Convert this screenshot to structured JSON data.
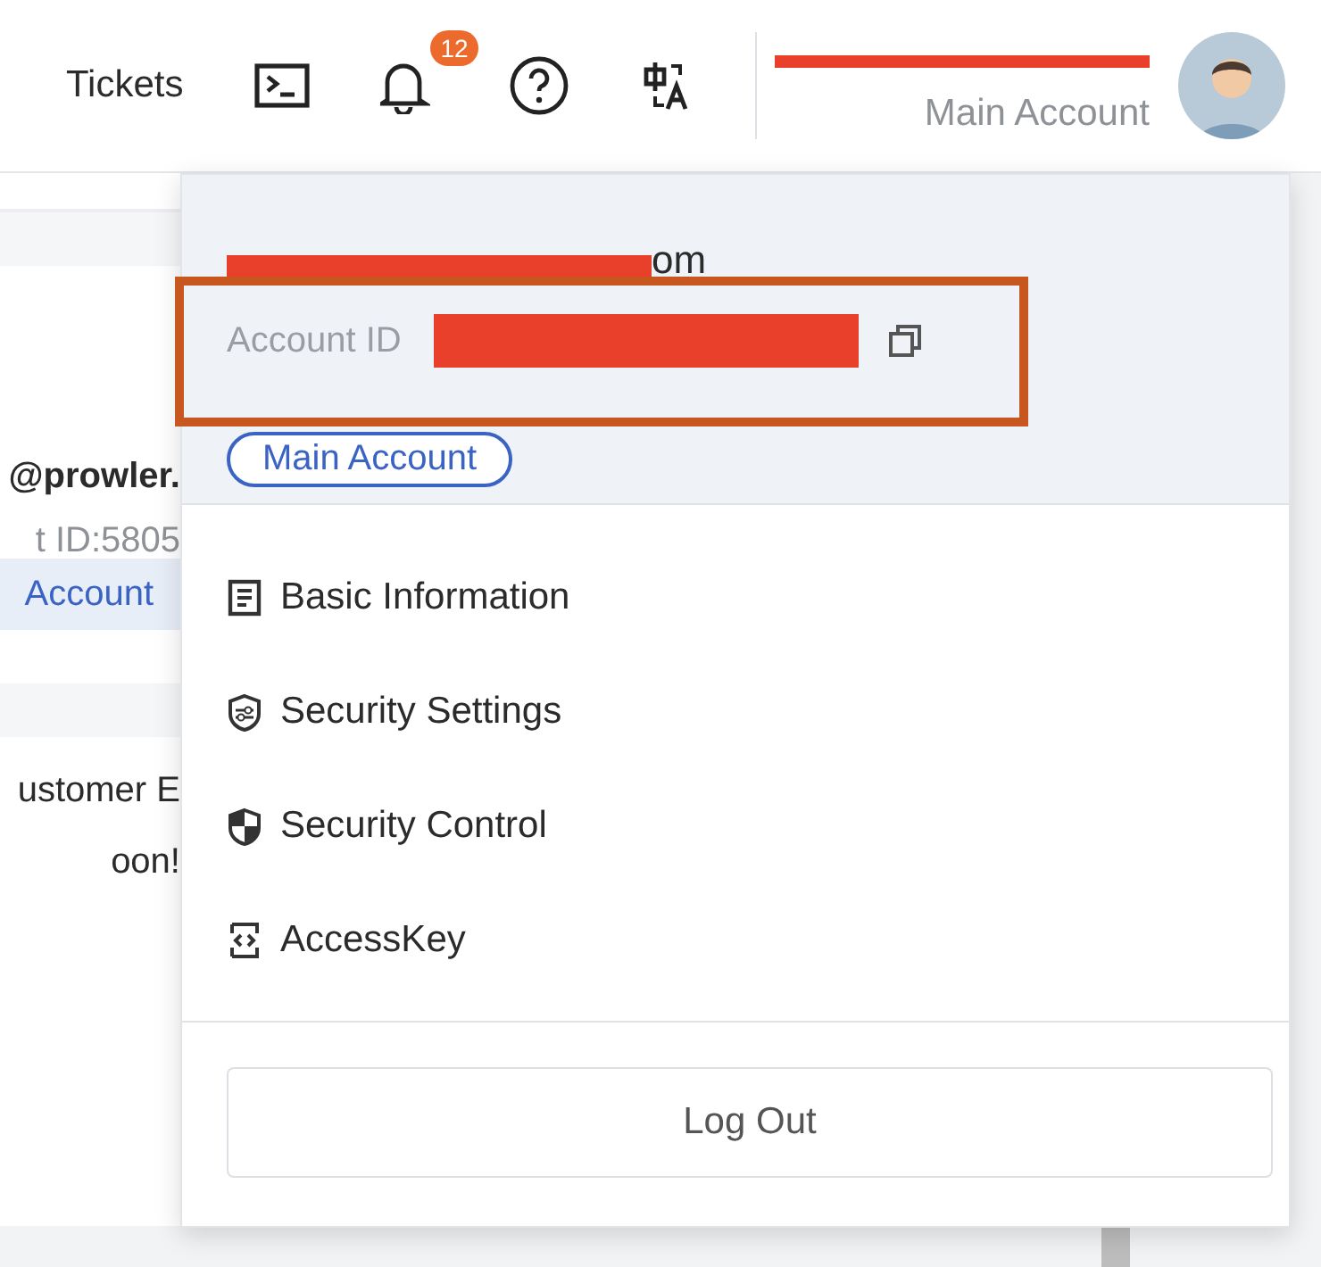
{
  "header": {
    "nav_link": "Tickets",
    "notifications": {
      "badge": "12"
    },
    "user": {
      "redacted": true,
      "role": "Main Account"
    }
  },
  "background": [
    {
      "kind": "email",
      "text": "@prowler."
    },
    {
      "kind": "id",
      "text": "t ID:5805"
    },
    {
      "kind": "tag",
      "text": "Account"
    },
    {
      "kind": "message",
      "text": "ustomer E"
    },
    {
      "kind": "message",
      "text": "oon!"
    }
  ],
  "account_menu": {
    "email": "om",
    "email_redacted": true,
    "account_id_label": "Account ID",
    "account_id_redacted": true,
    "highlighted": true,
    "account_type": "Main Account",
    "items": [
      {
        "kind": "document",
        "label": "Basic Information"
      },
      {
        "kind": "shield-settings",
        "label": "Security Settings"
      },
      {
        "kind": "shield",
        "label": "Security Control"
      },
      {
        "kind": "key",
        "label": "AccessKey"
      }
    ],
    "logout": "Log Out"
  }
}
